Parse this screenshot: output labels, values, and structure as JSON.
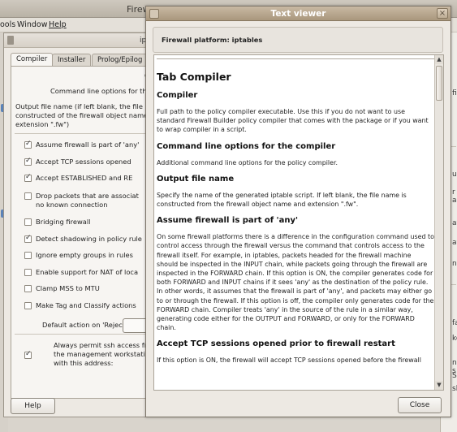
{
  "main_window": {
    "title": "Firew",
    "menu": [
      "ools",
      "Window",
      "Help"
    ],
    "right_fragments": [
      "fil",
      "u",
      "r a",
      "ay",
      "ay",
      "nfo",
      "fa",
      "ker",
      "n-s",
      "SI",
      "sh"
    ]
  },
  "dialog": {
    "title": "ip",
    "tabs": [
      "Compiler",
      "Installer",
      "Prolog/Epilog",
      "C"
    ],
    "panel_header": "C",
    "cmdline_label": "Command line options for the co",
    "output_label": [
      "Output file name (if left blank, the file name",
      "constructed of the firewall object name and",
      "extension \".fw\")"
    ],
    "options": [
      {
        "label": "Assume firewall is part of 'any'",
        "checked": true
      },
      {
        "label": "Accept TCP sessions opened",
        "checked": true
      },
      {
        "label": "Accept ESTABLISHED and RE",
        "checked": true
      },
      {
        "label": "Drop packets that are associat",
        "label2": "no known connection",
        "checked": false
      },
      {
        "label": "Bridging firewall",
        "checked": false
      },
      {
        "label": "Detect shadowing in policy rule",
        "checked": true
      },
      {
        "label": "Ignore empty groups in rules",
        "checked": false
      },
      {
        "label": "Enable support for NAT of loca",
        "checked": false
      },
      {
        "label": "Clamp MSS to MTU",
        "checked": false
      },
      {
        "label": "Make Tag and Classify actions",
        "checked": false
      }
    ],
    "reject_label": "Default action on 'Reject':",
    "ssh": {
      "lines": [
        "Always permit ssh access from",
        "the management workstation",
        "with this address:"
      ],
      "checked": true
    },
    "help_button": "Help"
  },
  "text_viewer": {
    "title": "Text viewer",
    "header": "Firewall platform: iptables",
    "doc_title": "Tab Compiler",
    "sections": [
      {
        "heading": "Compiler",
        "body": "Full path to the policy compiler executable. Use this if you do not want to use standard Firewall Builder policy compiler that comes with the package or if you want to wrap compiler in a script."
      },
      {
        "heading": "Command line options for the compiler",
        "body": "Additional command line options for the policy compiler."
      },
      {
        "heading": "Output file name",
        "body": "Specify the name of the generated iptable script. If left blank, the file name is constructed from the firewall object name and extension \".fw\"."
      },
      {
        "heading": "Assume firewall is part of 'any'",
        "body": "On some firewall platforms there is a difference in the configuration command used to control access through the firewall versus the command that controls access to the firewall itself. For example, in iptables, packets headed for the firewall machine should be inspected in the INPUT chain, while packets going through the firewall are inspected in the FORWARD chain. If this option is ON, the compiler generates code for both FORWARD and INPUT chains if it sees 'any' as the destination of the policy rule. In other words, it assumes that the firewall is part of 'any', and packets may either go to or through the firewall. If this option is off, the compiler only generates code for the FORWARD chain. Compiler treats 'any' in the source of the rule in a similar way, generating code either for the OUTPUT and FORWARD, or only for the FORWARD chain."
      },
      {
        "heading": "Accept TCP sessions opened prior to firewall restart",
        "body": "If this option is ON, the firewall will accept TCP sessions opened before the firewall"
      }
    ],
    "close_button": "Close"
  }
}
